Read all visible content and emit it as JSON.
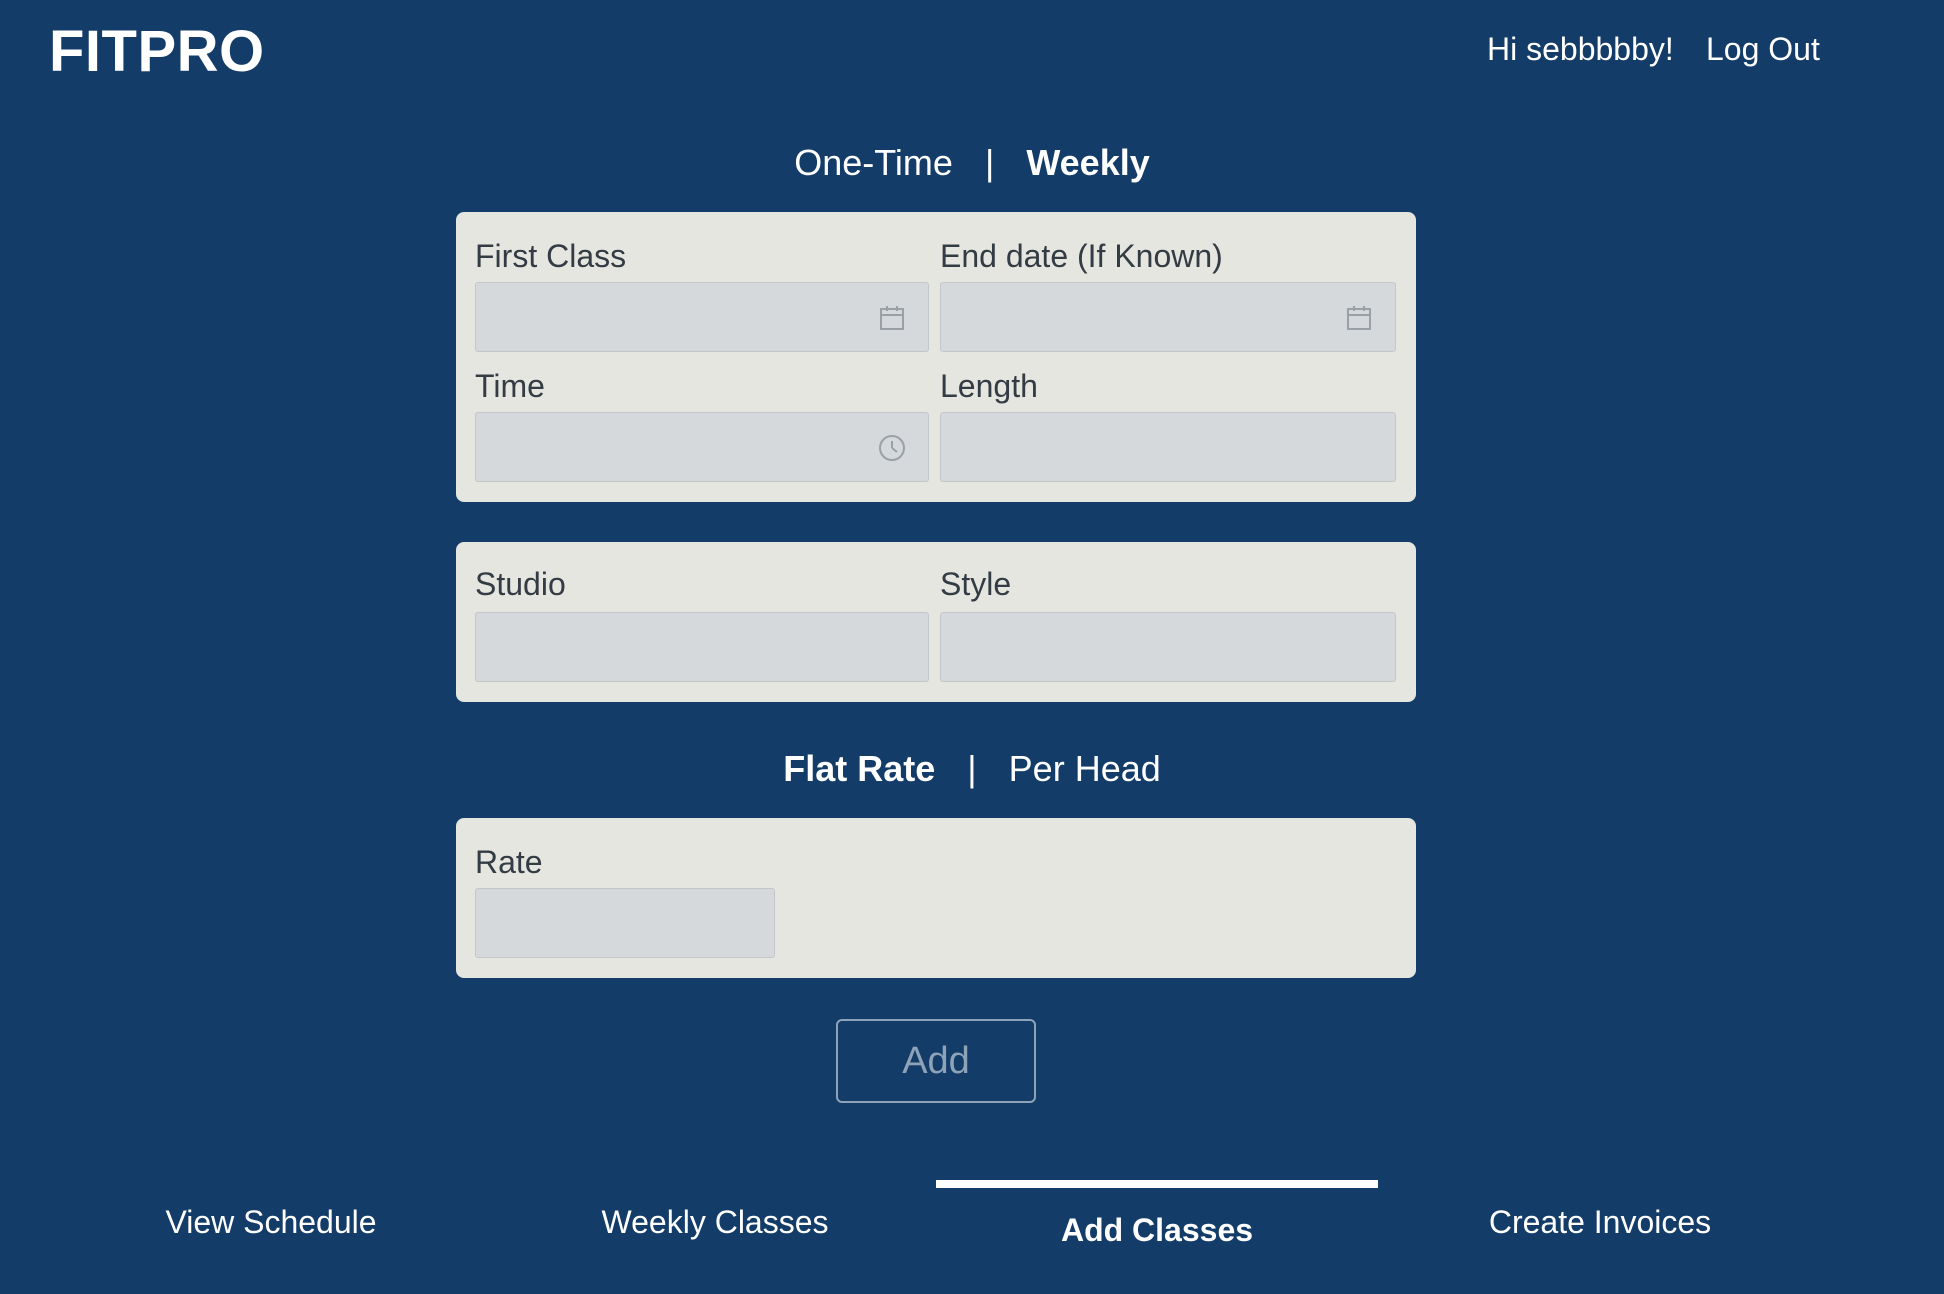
{
  "header": {
    "logo": "FITPRO",
    "greeting": "Hi sebbbbby!",
    "logout": "Log Out"
  },
  "schedule_toggle": {
    "one_time": "One-Time",
    "separator": "|",
    "weekly": "Weekly",
    "active": "Weekly"
  },
  "schedule_card": {
    "first_class_label": "First Class",
    "end_date_label": "End date (If Known)",
    "time_label": "Time",
    "length_label": "Length"
  },
  "details_card": {
    "studio_label": "Studio",
    "style_label": "Style"
  },
  "rate_toggle": {
    "flat_rate": "Flat Rate",
    "separator": "|",
    "per_head": "Per Head",
    "active": "Flat Rate"
  },
  "rate_card": {
    "rate_label": "Rate"
  },
  "add_button": "Add",
  "bottom_nav": {
    "items": [
      "View Schedule",
      "Weekly Classes",
      "Add Classes",
      "Create Invoices"
    ],
    "active": "Add Classes"
  },
  "colors": {
    "background": "#133c68",
    "card": "#e5e6df",
    "field": "#d5d9dc",
    "label": "#333c44",
    "button": "#8fa3b8"
  }
}
